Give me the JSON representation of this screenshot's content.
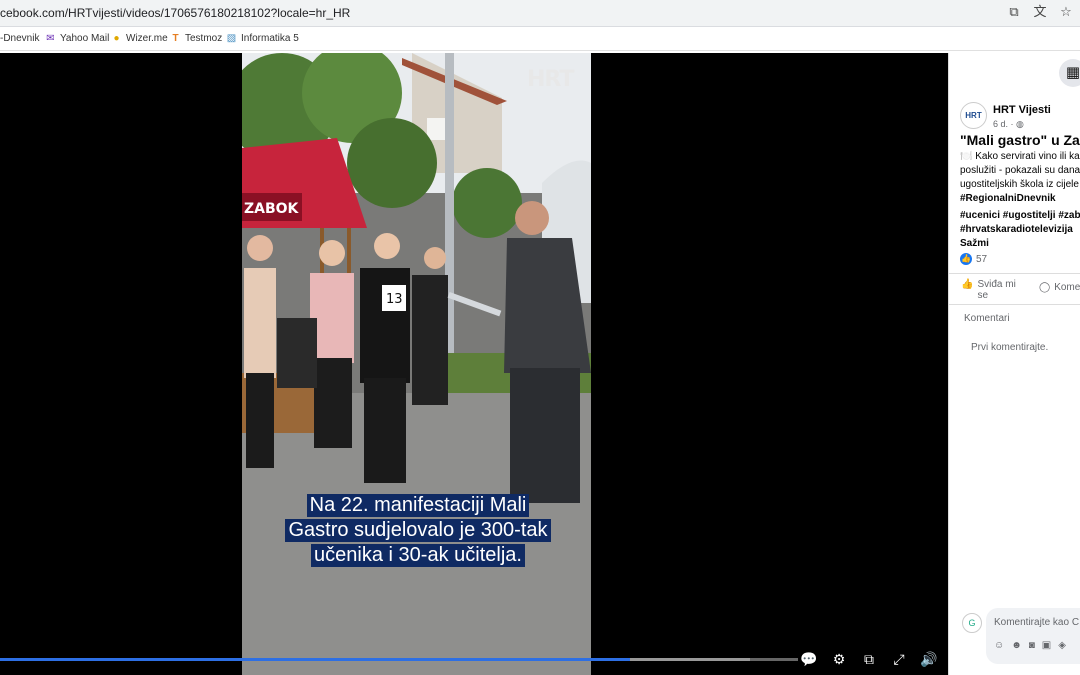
{
  "browser": {
    "url": "cebook.com/HRTvijesti/videos/1706576180218102?locale=hr_HR",
    "bookmarks": [
      {
        "label": "-Dnevnik",
        "icon": "page-icon"
      },
      {
        "label": "Yahoo Mail",
        "icon": "mail-icon"
      },
      {
        "label": "Wizer.me",
        "icon": "bulb-icon"
      },
      {
        "label": "Testmoz",
        "icon": "testmoz-icon"
      },
      {
        "label": "Informatika 5",
        "icon": "image-icon"
      }
    ]
  },
  "video": {
    "logo": "HRT",
    "caption_lines": [
      "Na 22. manifestaciji Mali",
      "Gastro sudjelovalo je 300-tak",
      "učenika i 30-ak učitelja."
    ],
    "sign_text": "ZABOK",
    "apron_number": "13",
    "progress": 0.79
  },
  "post": {
    "page_name": "HRT Vijesti",
    "time": "6 d. · ",
    "title": "\"Mali gastro\" u Zab",
    "body_lines": [
      "🍽️ Kako servirati vino ili ka",
      "poslužiti - pokazali su dana",
      "ugostiteljskih škola iz cijele"
    ],
    "body_tag": "#RegionalniDnevnik",
    "tag_lines": [
      "#ucenici #ugostitelji #zabo",
      "#hrvatskaradiotelevizija",
      "Sažmi"
    ],
    "like_count": "57",
    "like_label_1": "Sviđa mi",
    "like_label_2": "se",
    "comment_label": "Kome",
    "comments_heading": "Komentari",
    "first_comment": "Prvi komentirajte.",
    "composer_placeholder": "Komentirajte kao C"
  },
  "colors": {
    "accent": "#1877f2",
    "caption_bg": "#0f2a63",
    "progress": "#2d6fe4"
  }
}
